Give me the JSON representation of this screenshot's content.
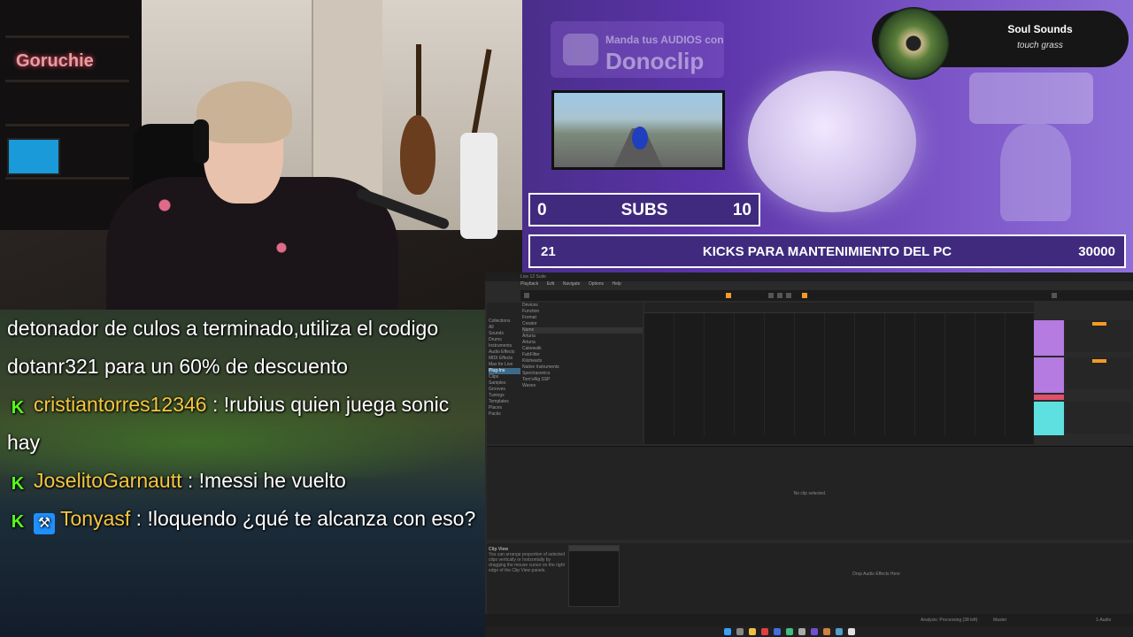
{
  "webcam": {
    "wall_sign": "Goruchie"
  },
  "chat": {
    "messages": [
      {
        "text_only": "detonador de culos a terminado,utiliza el codigo dotanr321 para un 60% de descuento"
      },
      {
        "badge": "K",
        "user": "cristiantorres12346",
        "sep": " : ",
        "text": "!rubius quien juega sonic hay"
      },
      {
        "badge": "K",
        "user": "JoselitoGarnautt",
        "sep": " : ",
        "text": "!messi he vuelto"
      },
      {
        "badge": "K",
        "badge2": "⚒",
        "user": "Tonyasf",
        "sep": " : ",
        "text": "!loquendo ¿qué te alcanza con eso?"
      }
    ]
  },
  "overlay": {
    "donoclip_small": "Manda tus AUDIOS con",
    "donoclip_big": "Donoclip",
    "song": {
      "title": "Soul Sounds",
      "artist": "touch grass"
    },
    "goal_subs": {
      "current": "0",
      "label": "SUBS",
      "target": "10"
    },
    "goal_kicks": {
      "current": "21",
      "label": "KICKS PARA MANTENIMIENTO DEL PC",
      "target": "30000"
    }
  },
  "daw": {
    "title": "Live 12 Suite",
    "menu": [
      "Playback",
      "Edit",
      "Navigate",
      "Options",
      "Help"
    ],
    "browser_left": [
      "Collections",
      "All",
      "Sounds",
      "Drums",
      "Instruments",
      "Audio Effects",
      "MIDI Effects",
      "Max for Live",
      "Plug-Ins",
      "Clips",
      "Samples",
      "Grooves",
      "Tunings",
      "Templates",
      "Places",
      "Packs"
    ],
    "browser_right_header": "Name",
    "browser_right": [
      "Devices",
      "Function",
      "Format",
      "Creator",
      "Name",
      "Arturia",
      "Arturia",
      "Cakewalk",
      "FabFilter",
      "Kilohearts",
      "Native Instruments",
      "Spectrasonics",
      "Tom'sAlg SSP",
      "Waves"
    ],
    "detail_message": "No clip selected.",
    "clip_view_title": "Clip View",
    "clip_view_text": "You can arrange proportion of selected clips vertically or horizontally by dragging the mouse cursor on the right edge of the Clip View panels.",
    "drop_message": "Drop Audio Effects Here",
    "status_processing": "Analysis: Processing (38 left)",
    "status_track": "Master",
    "status_master": "1-Audio"
  },
  "colors": {
    "goal_bg": "#3f2a7e",
    "kick_green": "#53fc18",
    "username_gold": "#f5c73f",
    "daw_accent": "#f59a23"
  }
}
